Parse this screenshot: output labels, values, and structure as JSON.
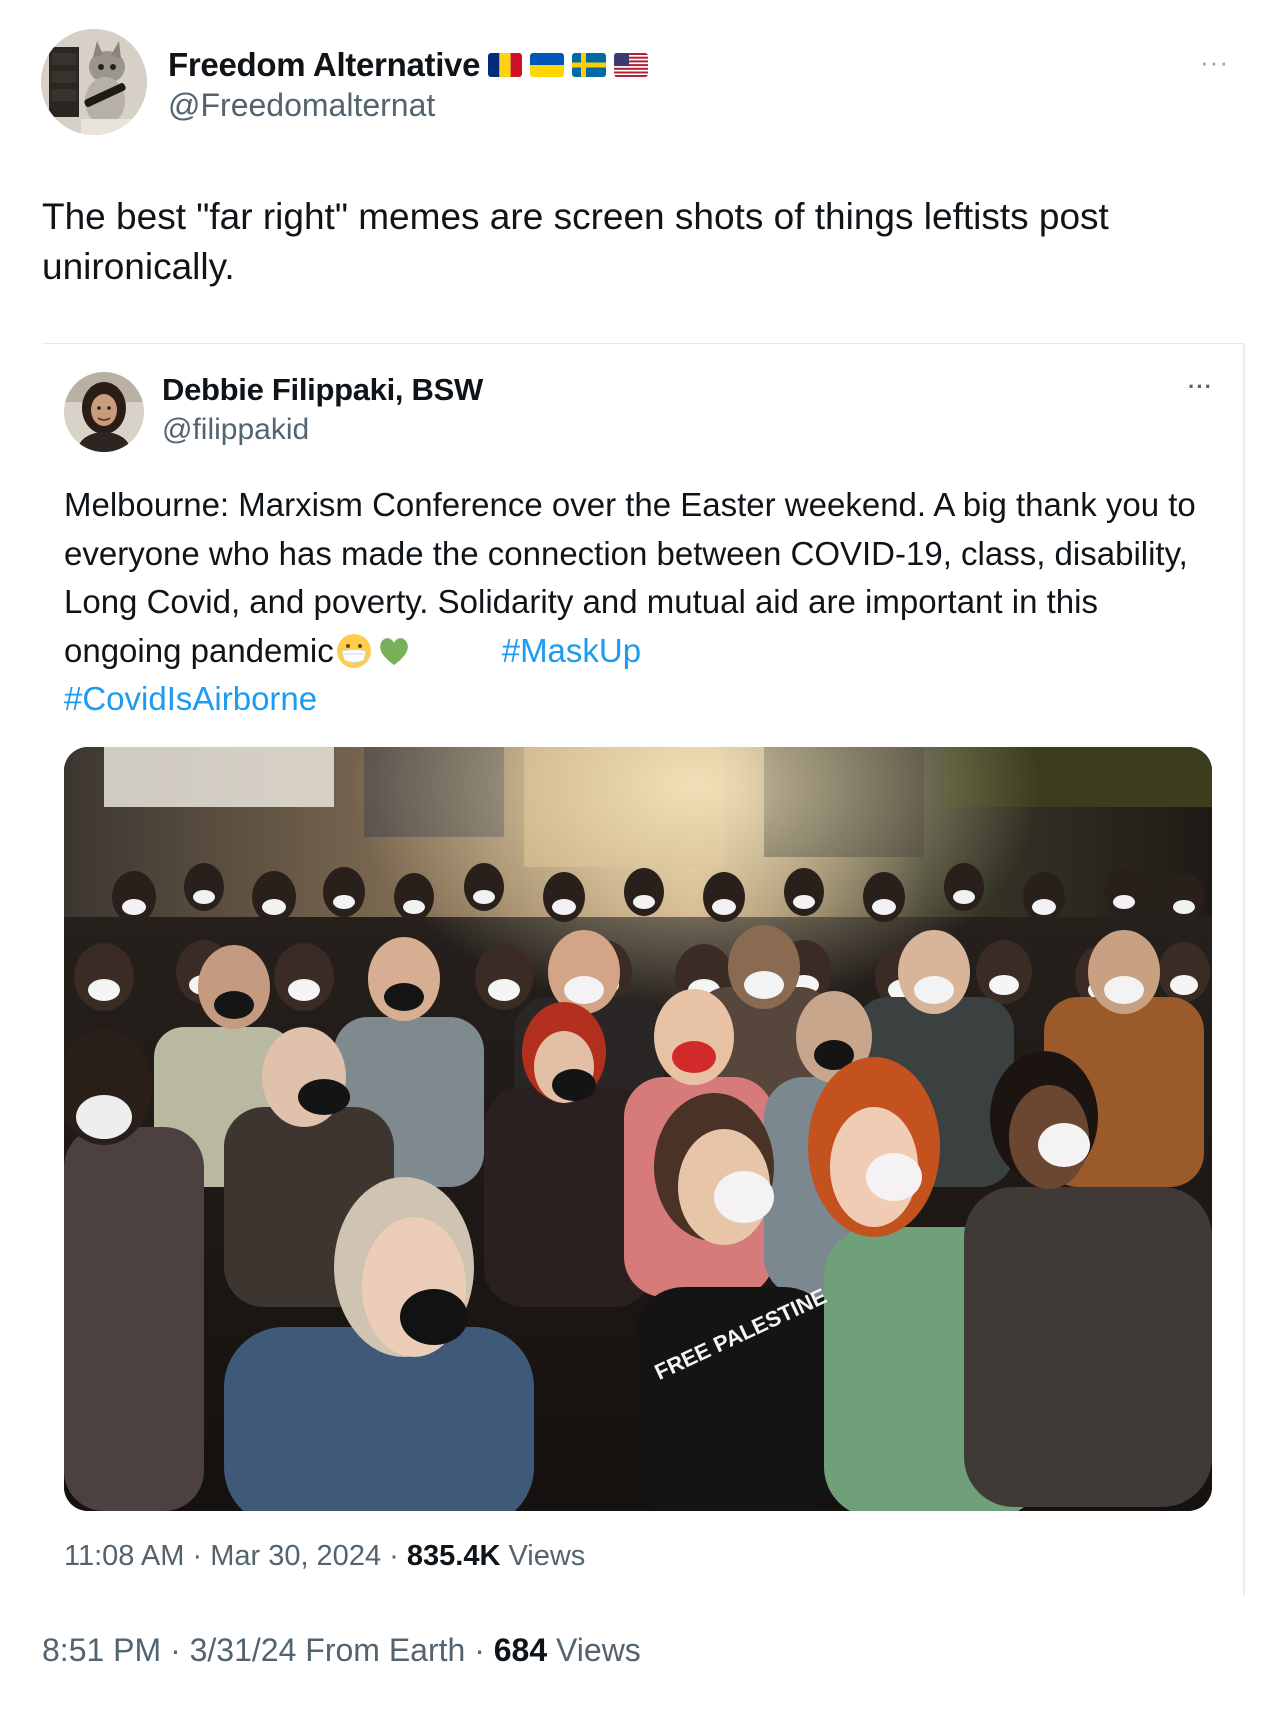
{
  "tweet": {
    "author_name": "Freedom Alternative",
    "author_handle": "@Freedomalternat",
    "flags": [
      "romania-flag-icon",
      "ukraine-flag-icon",
      "sweden-flag-icon",
      "usa-flag-icon"
    ],
    "more_label": "···",
    "text": "The best \"far right\" memes are screen shots of things leftists post unironically.",
    "time": "8:51 PM",
    "date": "3/31/24",
    "source": "From Earth",
    "views_count": "684",
    "views_label": "Views",
    "separator": "·"
  },
  "quoted_tweet": {
    "author_name": "Debbie Filippaki, BSW",
    "author_handle": "@filippakid",
    "more_label": "···",
    "text": "Melbourne: Marxism Conference over the Easter weekend. A big thank you to everyone who has made the connection between COVID-19, class, disability, Long Covid, and poverty. Solidarity and mutual aid are important in this ongoing pandemic",
    "emojis": [
      "mask-face-emoji",
      "green-heart-emoji"
    ],
    "hashtags": [
      "#MaskUp",
      "#CovidIsAirborne"
    ],
    "time": "11:08 AM",
    "date": "Mar 30, 2024",
    "views_count": "835.4K",
    "views_label": "Views",
    "separator": "·",
    "photo_overlay_text": "FREE PALESTINE"
  }
}
